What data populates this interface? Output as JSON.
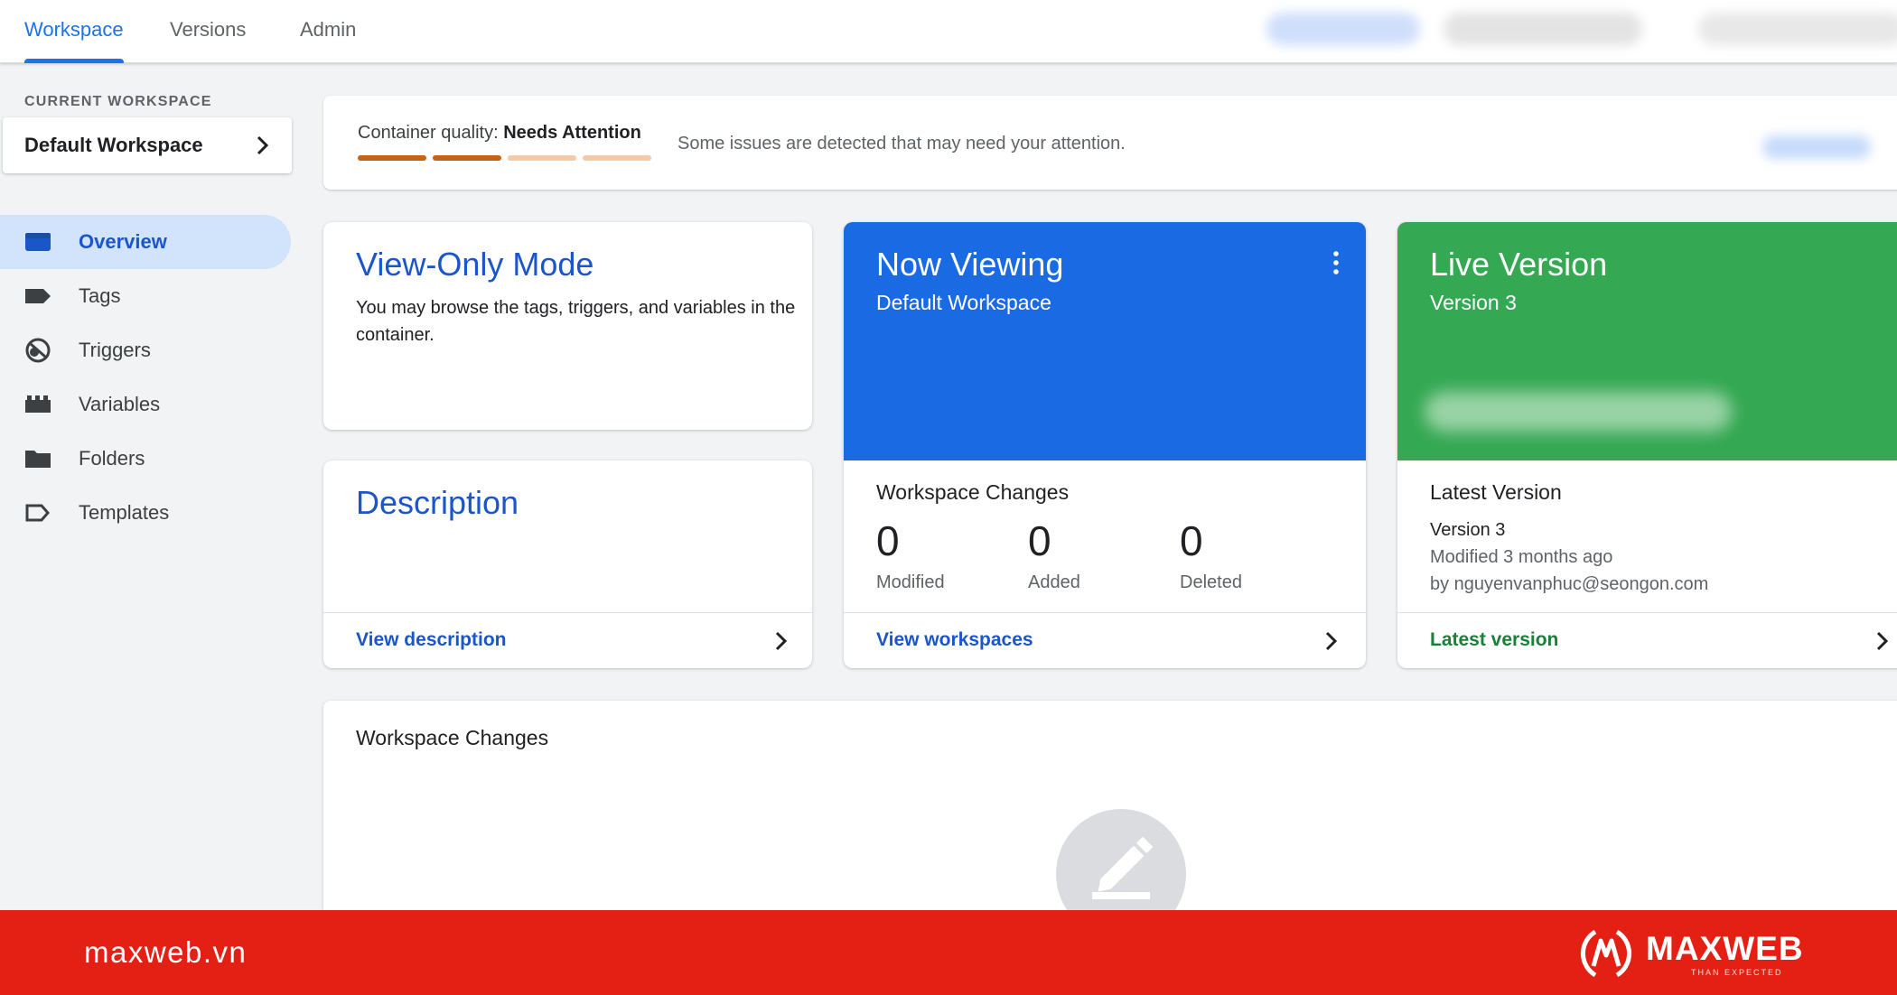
{
  "nav_tabs": [
    {
      "label": "Workspace",
      "active": true
    },
    {
      "label": "Versions",
      "active": false
    },
    {
      "label": "Admin",
      "active": false
    }
  ],
  "sidebar": {
    "current_workspace_label": "CURRENT WORKSPACE",
    "workspace_name": "Default Workspace",
    "items": [
      {
        "label": "Overview",
        "icon": "overview-icon",
        "active": true
      },
      {
        "label": "Tags",
        "icon": "tag-icon",
        "active": false
      },
      {
        "label": "Triggers",
        "icon": "trigger-icon",
        "active": false
      },
      {
        "label": "Variables",
        "icon": "variables-icon",
        "active": false
      },
      {
        "label": "Folders",
        "icon": "folder-icon",
        "active": false
      },
      {
        "label": "Templates",
        "icon": "template-icon",
        "active": false
      }
    ]
  },
  "quality": {
    "label": "Container quality:",
    "status": "Needs Attention",
    "level_filled": 2,
    "level_total": 4,
    "message": "Some issues are detected that may need your attention."
  },
  "view_only_card": {
    "title": "View-Only Mode",
    "text": "You may browse the tags, triggers, and variables in the container."
  },
  "description_card": {
    "title": "Description",
    "link": "View description"
  },
  "now_viewing_card": {
    "title": "Now Viewing",
    "subtitle": "Default Workspace",
    "section_title": "Workspace Changes",
    "stats": [
      {
        "value": "0",
        "label": "Modified"
      },
      {
        "value": "0",
        "label": "Added"
      },
      {
        "value": "0",
        "label": "Deleted"
      }
    ],
    "link": "View workspaces"
  },
  "live_version_card": {
    "title": "Live Version",
    "subtitle": "Version 3",
    "section_title": "Latest Version",
    "version": "Version 3",
    "modified": "Modified 3 months ago",
    "author": "by nguyenvanphuc@seongon.com",
    "link": "Latest version"
  },
  "changes_panel": {
    "title": "Workspace Changes"
  },
  "brand_bar": {
    "site": "maxweb.vn",
    "name": "MAXWEB",
    "tagline": "THAN EXPECTED"
  },
  "colors": {
    "primary_blue": "#1a73e8",
    "hero_blue": "#1a6ae3",
    "live_green": "#34a853",
    "quality_filled": "#c5621a",
    "quality_empty": "#f3cba9",
    "brand_red": "#e41f13"
  }
}
